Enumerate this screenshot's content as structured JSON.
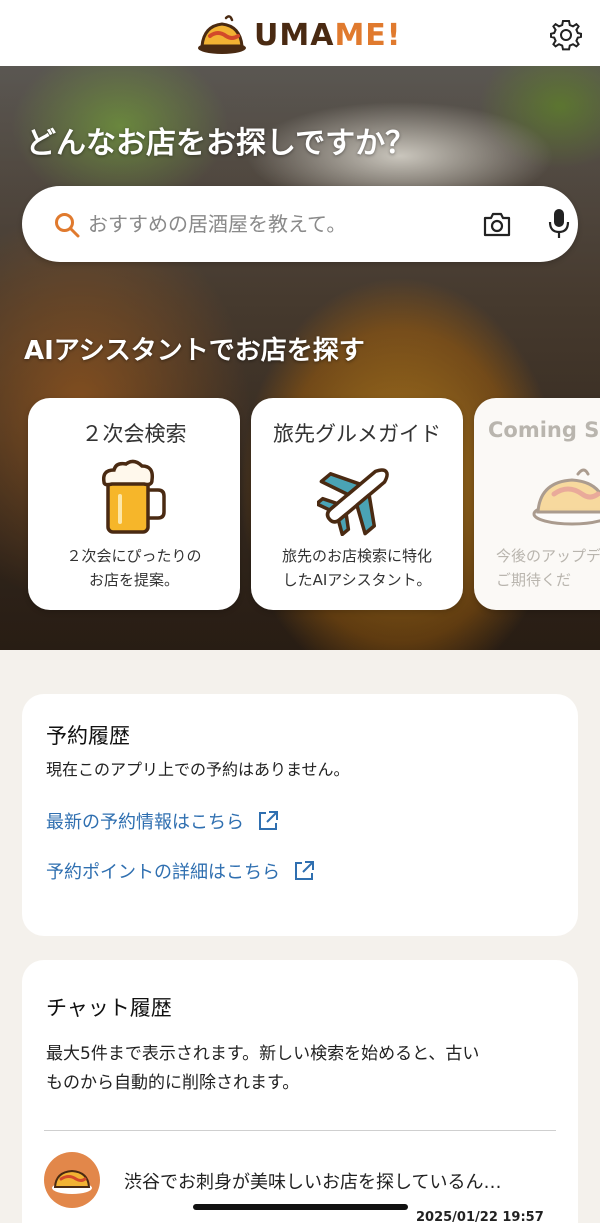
{
  "header": {
    "logo_text_a": "UMA",
    "logo_text_b": "ME!",
    "settings_icon": "gear-icon"
  },
  "hero": {
    "title": "どんなお店をお探しですか？",
    "search": {
      "placeholder": "おすすめの居酒屋を教えて。",
      "search_icon": "search-icon",
      "camera_icon": "camera-icon",
      "mic_icon": "microphone-icon"
    },
    "ai_section_title_prefix": "AI",
    "ai_section_title_rest": "アシスタントでお店を探す",
    "cards": [
      {
        "title": "２次会検索",
        "icon": "beer-mug-icon",
        "desc_line1": "２次会にぴったりの",
        "desc_line2": "お店を提案。"
      },
      {
        "title": "旅先グルメガイド",
        "icon": "airplane-icon",
        "desc_line1": "旅先のお店検索に特化",
        "desc_line2": "したAIアシスタント。"
      },
      {
        "title": "Coming S",
        "icon": "omurice-icon",
        "desc_line1": "今後のアップデ",
        "desc_line2": "ご期待くだ"
      }
    ]
  },
  "reservation": {
    "title": "予約履歴",
    "empty_text": "現在このアプリ上での予約はありません。",
    "link1": "最新の予約情報はこちら",
    "link2": "予約ポイントの詳細はこちら"
  },
  "chat_history": {
    "title": "チャット履歴",
    "note_line1": "最大5件まで表示されます。新しい検索を始めると、古い",
    "note_line2": "ものから自動的に削除されます。",
    "items": [
      {
        "title": "渋谷でお刺身が美味しいお店を探しているん…",
        "timestamp": "2025/01/22 19:57"
      }
    ]
  },
  "colors": {
    "brand_dark": "#4a2a12",
    "brand_accent": "#e07a2e",
    "link": "#2f6fb0",
    "background": "#f4f1ec"
  }
}
